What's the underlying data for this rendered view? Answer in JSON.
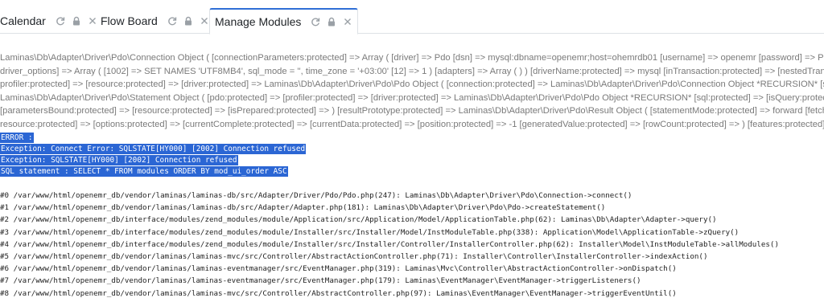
{
  "tabs": [
    {
      "label": "Calendar"
    },
    {
      "label": "Flow Board"
    },
    {
      "label": "Manage Modules"
    }
  ],
  "dump_lines": [
    "Laminas\\Db\\Adapter\\Driver\\Pdo\\Connection Object ( [connectionParameters:protected] => Array ( [driver] => Pdo [dsn] => mysql:dbname=openemr;host=ohemrdb01 [username] => openemr [password] => P@$",
    "driver_options] => Array ( [1002] => SET NAMES 'UTF8MB4', sql_mode = '', time_zone = '+03:00' [12] => 1 ) [adapters] => Array ( ) ) [driverName:protected] => mysql [inTransaction:protected] => [nestedTransa",
    "profiler:protected] => [resource:protected] => [driver:protected] => Laminas\\Db\\Adapter\\Driver\\Pdo\\Pdo Object ( [connection:protected] => Laminas\\Db\\Adapter\\Driver\\Pdo\\Connection Object *RECURSION* [sta",
    "Laminas\\Db\\Adapter\\Driver\\Pdo\\Statement Object ( [pdo:protected] => [profiler:protected] => [driver:protected] => Laminas\\Db\\Adapter\\Driver\\Pdo\\Pdo Object *RECURSION* [sql:protected] => [isQuery:protected",
    "[parametersBound:protected] => [resource:protected] => [isPrepared:protected] => ) [resultPrototype:protected] => Laminas\\Db\\Adapter\\Driver\\Pdo\\Result Object ( [statementMode:protected] => forward [fetch",
    "resource:protected] => [options:protected] => [currentComplete:protected] => [currentData:protected] => [position:protected] => -1 [generatedValue:protected] => [rowCount:protected] => ) [features:protected] =>"
  ],
  "error_lines": [
    "ERROR :",
    "Exception: Connect Error: SQLSTATE[HY000] [2002] Connection refused",
    "Exception: SQLSTATE[HY000] [2002] Connection refused",
    "SQL statement : SELECT * FROM modules ORDER BY mod_ui_order ASC"
  ],
  "trace_lines": [
    "#0 /var/www/html/openemr_db/vendor/laminas/laminas-db/src/Adapter/Driver/Pdo/Pdo.php(247): Laminas\\Db\\Adapter\\Driver\\Pdo\\Connection->connect()",
    "#1 /var/www/html/openemr_db/vendor/laminas/laminas-db/src/Adapter/Adapter.php(181): Laminas\\Db\\Adapter\\Driver\\Pdo\\Pdo->createStatement()",
    "#2 /var/www/html/openemr_db/interface/modules/zend_modules/module/Application/src/Application/Model/ApplicationTable.php(62): Laminas\\Db\\Adapter\\Adapter->query()",
    "#3 /var/www/html/openemr_db/interface/modules/zend_modules/module/Installer/src/Installer/Model/InstModuleTable.php(338): Application\\Model\\ApplicationTable->zQuery()",
    "#4 /var/www/html/openemr_db/interface/modules/zend_modules/module/Installer/src/Installer/Controller/InstallerController.php(62): Installer\\Model\\InstModuleTable->allModules()",
    "#5 /var/www/html/openemr_db/vendor/laminas/laminas-mvc/src/Controller/AbstractActionController.php(71): Installer\\Controller\\InstallerController->indexAction()",
    "#6 /var/www/html/openemr_db/vendor/laminas/laminas-eventmanager/src/EventManager.php(319): Laminas\\Mvc\\Controller\\AbstractActionController->onDispatch()",
    "#7 /var/www/html/openemr_db/vendor/laminas/laminas-eventmanager/src/EventManager.php(179): Laminas\\EventManager\\EventManager->triggerListeners()",
    "#8 /var/www/html/openemr_db/vendor/laminas/laminas-mvc/src/Controller/AbstractController.php(97): Laminas\\EventManager\\EventManager->triggerEventUntil()"
  ]
}
